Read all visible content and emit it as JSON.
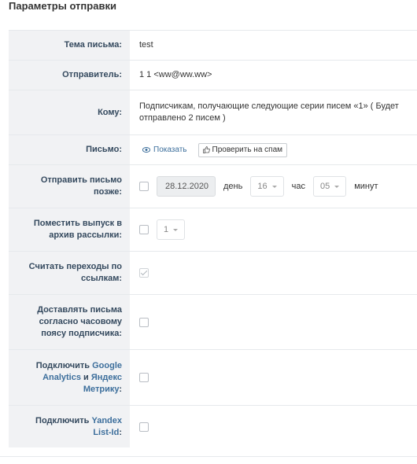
{
  "page": {
    "title": "Параметры отправки"
  },
  "subject": {
    "label": "Тема письма:",
    "value": "test"
  },
  "sender": {
    "label": "Отправитель:",
    "value": "1 1 <ww@ww.ww>"
  },
  "recipients": {
    "label": "Кому:",
    "value": "Подписчикам, получающие следующие серии писем «1» ( Будет отправлено 2 писем )"
  },
  "letter": {
    "label": "Письмо:",
    "show_label": "Показать",
    "spam_check_label": "Проверить на спам"
  },
  "send_later": {
    "label": "Отправить письмо позже:",
    "date": "28.12.2020",
    "day_word": "день",
    "hour_value": "16",
    "hour_word": "час",
    "minute_value": "05",
    "minute_word": "минут"
  },
  "archive": {
    "label": "Поместить выпуск в архив рассылки:",
    "issue_value": "1"
  },
  "track_clicks": {
    "label": "Считать переходы по ссылкам:",
    "checked": true
  },
  "timezone": {
    "label": "Доставлять письма согласно часовому поясу подписчика:"
  },
  "analytics": {
    "label_part1": "Подключить ",
    "label_google": "Google Analytics",
    "label_part2": " и ",
    "label_yandex": "Яндекс Метрику",
    "label_part3": ":"
  },
  "list_id": {
    "label_part1": "Подключить ",
    "label_link": "Yandex List-Id",
    "label_part2": ":"
  }
}
